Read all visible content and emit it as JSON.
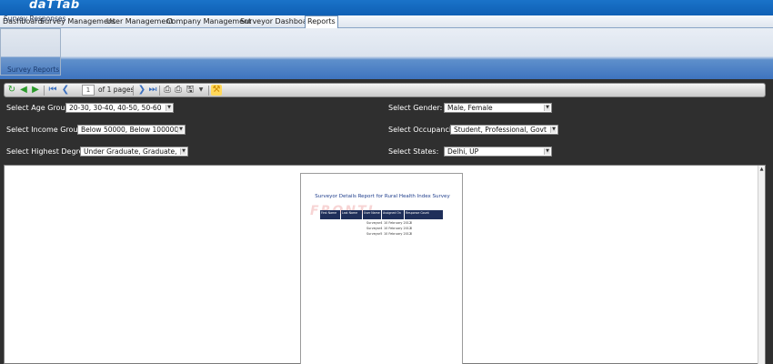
{
  "app": {
    "logo": "daTTab"
  },
  "nav": {
    "items": [
      {
        "label": "Dashboard"
      },
      {
        "label": "Survey Management"
      },
      {
        "label": "User Management"
      },
      {
        "label": "Company Management"
      },
      {
        "label": "Surveyor Dashboard"
      },
      {
        "label": "Reports",
        "active": true
      }
    ]
  },
  "subnav": {
    "items": [
      {
        "label": "Survey Responses"
      },
      {
        "label": "Survey Reports",
        "active": true
      }
    ]
  },
  "toolbar": {
    "current_page": "1",
    "of_pages": "of 1 pages",
    "icons": [
      "refresh-icon",
      "back-icon",
      "forward-icon",
      "first-page-icon",
      "prev-page-icon",
      "next-page-icon",
      "last-page-icon",
      "print-layout-icon",
      "print-icon",
      "save-icon",
      "save-dropdown-icon",
      "parameters-icon"
    ]
  },
  "filters": {
    "age": {
      "label": "Select Age Groups:",
      "value": "20-30, 30-40, 40-50, 50-60"
    },
    "income": {
      "label": "Select Income Groups:",
      "value": "Below 50000, Below 100000"
    },
    "degree": {
      "label": "Select Highest Degrees:",
      "value": "Under Graduate, Graduate,"
    },
    "gender": {
      "label": "Select Gender:",
      "value": "Male, Female"
    },
    "occupancy": {
      "label": "Select Occupancies:",
      "value": "Student, Professional, Govt"
    },
    "states": {
      "label": "Select States:",
      "value": "Delhi, UP"
    }
  },
  "report": {
    "title": "Surveyor Details Report for Rural Health Index Survey",
    "watermark": "FRONTI",
    "columns": [
      "First Name",
      "Last Name",
      "User Name",
      "Assigned On",
      "Response Count"
    ],
    "rows": [
      {
        "user": "Surveyor4",
        "assigned": "10 February 2012",
        "count": "0"
      },
      {
        "user": "Surveyor4",
        "assigned": "10 February 2012",
        "count": "0"
      },
      {
        "user": "Surveyor5",
        "assigned": "10 February 2012",
        "count": "0"
      }
    ]
  },
  "colors": {
    "header_blue": "#1a73c9",
    "dark_panel": "#2f2f2f",
    "report_header": "#1f2f5a",
    "report_title": "#1f3e8c"
  }
}
